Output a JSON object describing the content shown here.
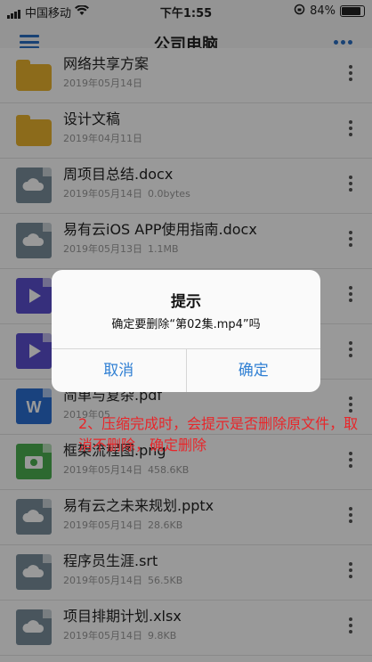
{
  "status_bar": {
    "carrier": "中国移动",
    "time": "下午1:55",
    "battery": "84%"
  },
  "nav": {
    "title": "公司电脑",
    "menu_icon": "hamburger-icon",
    "more_icon": "more-dots-icon"
  },
  "files": [
    {
      "name": "网络共享方案",
      "date": "2019年05月14日",
      "size": "",
      "type": "folder"
    },
    {
      "name": "设计文稿",
      "date": "2019年04月11日",
      "size": "",
      "type": "folder"
    },
    {
      "name": "周项目总结.docx",
      "date": "2019年05月14日",
      "size": "0.0bytes",
      "type": "cloud"
    },
    {
      "name": "易有云iOS APP使用指南.docx",
      "date": "2019年05月13日",
      "size": "1.1MB",
      "type": "cloud"
    },
    {
      "name": "",
      "date": "",
      "size": "",
      "type": "video"
    },
    {
      "name": "",
      "date": "",
      "size": "",
      "type": "video"
    },
    {
      "name": "简单与复杂.pdf",
      "date": "2019年05",
      "size": "",
      "type": "word"
    },
    {
      "name": "框架流程图.png",
      "date": "2019年05月14日",
      "size": "458.6KB",
      "type": "image"
    },
    {
      "name": "易有云之未来规划.pptx",
      "date": "2019年05月14日",
      "size": "28.6KB",
      "type": "cloud"
    },
    {
      "name": "程序员生涯.srt",
      "date": "2019年05月14日",
      "size": "56.5KB",
      "type": "cloud"
    },
    {
      "name": "项目排期计划.xlsx",
      "date": "2019年05月14日",
      "size": "9.8KB",
      "type": "cloud"
    }
  ],
  "colors": {
    "folder": "#e9b22d",
    "cloud": "#7a8e9c",
    "video": "#5a4fcf",
    "word": "#2b6fd3",
    "image": "#4caf50",
    "accent": "#2f7fd3",
    "annotation": "#e8262a"
  },
  "dialog": {
    "title": "提示",
    "message": "确定要删除“第02集.mp4”吗",
    "cancel": "取消",
    "confirm": "确定"
  },
  "annotation": "2、压缩完成时，会提示是否删除原文件，取消不删除，确定删除"
}
